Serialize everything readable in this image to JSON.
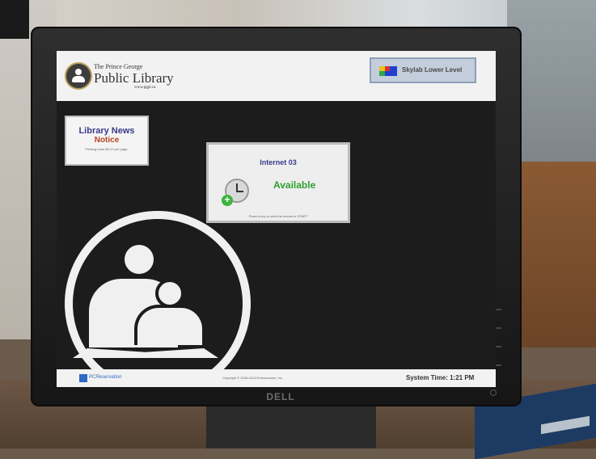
{
  "header": {
    "library_small": "The Prince George",
    "library_name": "Public Library",
    "library_url": "www.pgpl.ca"
  },
  "location_button": {
    "label": "Skylab Lower Level"
  },
  "news": {
    "title": "Library News",
    "notice": "Notice",
    "text": "Printing costs $0.20 per page."
  },
  "computer_card": {
    "name": "Internet 03",
    "status": "Available",
    "hint": "Press a key or click the mouse to START"
  },
  "footer": {
    "brand": "PCReservation",
    "copyright": "Copyright © 2006-2013 Envisionware, Inc.",
    "system_time_label": "System Time:",
    "system_time": "1:21 PM"
  },
  "monitor": {
    "brand": "DELL"
  },
  "colors": {
    "card_status": "#2e9f2e",
    "news_notice": "#b8431e",
    "title_blue": "#3a3a8a"
  }
}
